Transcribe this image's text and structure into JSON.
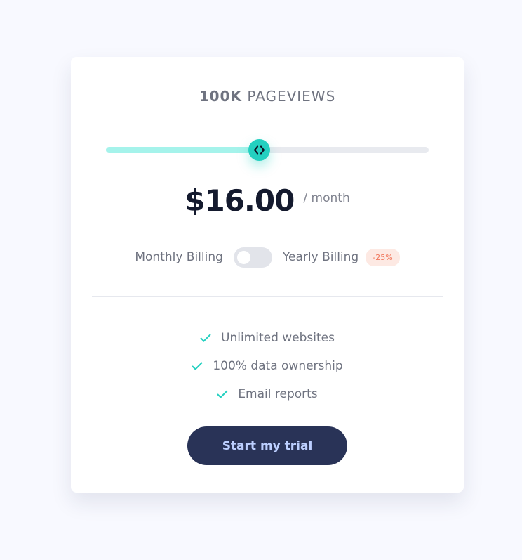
{
  "pricing": {
    "pageviews_count": "100K",
    "pageviews_label": "Pageviews",
    "slider_value_fraction": 0.475,
    "price": "$16.00",
    "period": "/ month",
    "billing": {
      "monthly_label": "Monthly Billing",
      "yearly_label": "Yearly Billing",
      "discount_badge": "-25%",
      "yearly_selected": false
    },
    "features": [
      {
        "icon": "check-icon",
        "label": "Unlimited websites"
      },
      {
        "icon": "check-icon",
        "label": "100% data ownership"
      },
      {
        "icon": "check-icon",
        "label": "Email reports"
      }
    ],
    "cta_label": "Start my trial",
    "colors": {
      "accent": "#24d0c0",
      "slider_fill": "#a5f3eb",
      "cta_bg": "#293357",
      "cta_text": "#bccfff",
      "discount_bg": "#fde9e3",
      "discount_text": "#f1755a"
    }
  }
}
